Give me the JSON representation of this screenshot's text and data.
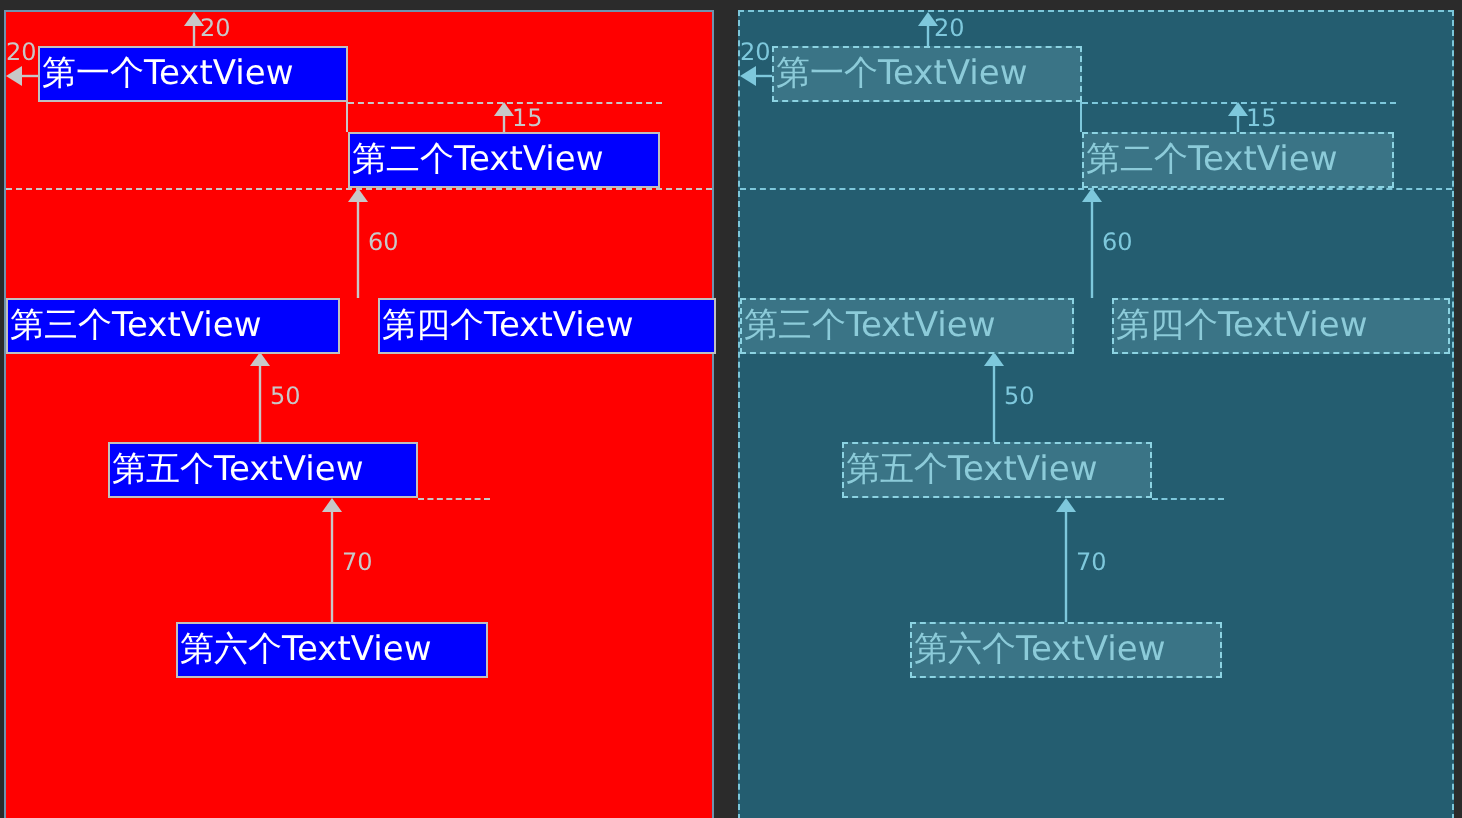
{
  "panels": [
    {
      "kind": "design",
      "views": [
        {
          "label": "第一个TextView"
        },
        {
          "label": "第二个TextView"
        },
        {
          "label": "第三个TextView"
        },
        {
          "label": "第四个TextView"
        },
        {
          "label": "第五个TextView"
        },
        {
          "label": "第六个TextView"
        }
      ],
      "margins": [
        "20",
        "20",
        "15",
        "60",
        "50",
        "70"
      ]
    },
    {
      "kind": "blueprint",
      "views": [
        {
          "label": "第一个TextView"
        },
        {
          "label": "第二个TextView"
        },
        {
          "label": "第三个TextView"
        },
        {
          "label": "第四个TextView"
        },
        {
          "label": "第五个TextView"
        },
        {
          "label": "第六个TextView"
        }
      ],
      "margins": [
        "20",
        "20",
        "15",
        "60",
        "50",
        "70"
      ]
    }
  ]
}
